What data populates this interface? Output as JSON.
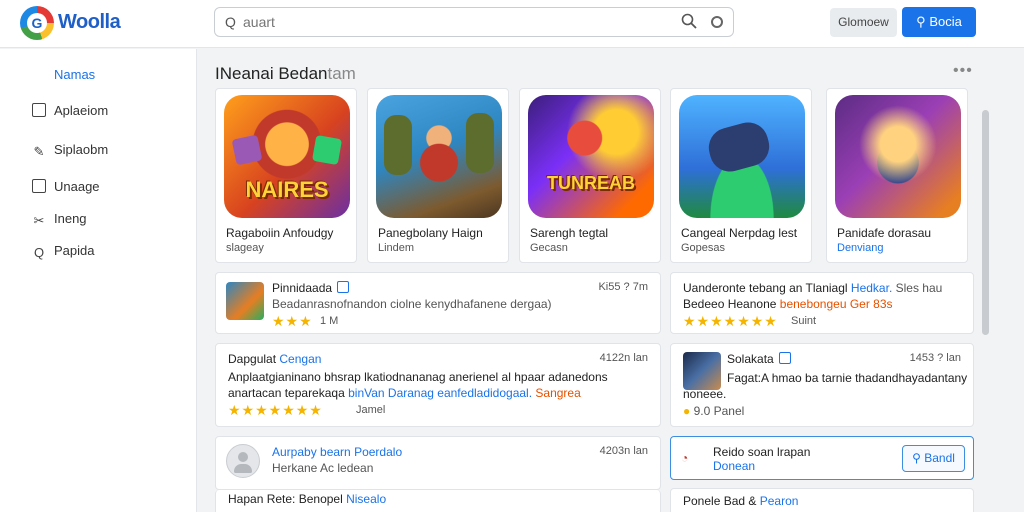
{
  "header": {
    "brand": "Woolla",
    "search_placeholder": "auart",
    "secondary_button": "Glomoew",
    "primary_button": "Bocia"
  },
  "sidebar": {
    "heading": "Namas",
    "items": [
      {
        "label": "Aplaeiom",
        "icon": "square-icon"
      },
      {
        "label": "Siplaobm",
        "icon": "pencil-icon"
      },
      {
        "label": "Unaage",
        "icon": "square-icon"
      },
      {
        "label": "Ineng",
        "icon": "scissors-icon"
      },
      {
        "label": "Papida",
        "icon": "search-icon"
      }
    ]
  },
  "main": {
    "section_title": "INeanai Bedan",
    "section_title_faded": "tam",
    "featured": [
      {
        "tile_word": "NAIRES",
        "title": "Ragaboiin Anfoudgy",
        "subtitle": "slageay",
        "subtitle_blue": false
      },
      {
        "tile_word": "",
        "title": "Panegbolany Haign",
        "subtitle": "Lindem",
        "subtitle_blue": false
      },
      {
        "tile_word": "TUNREAB",
        "title": "Sarengh tegtal",
        "subtitle": "Gecasn",
        "subtitle_blue": false
      },
      {
        "tile_word": "",
        "title": "Cangeal Nerpdag lest",
        "subtitle": "Gopesas",
        "subtitle_blue": false
      },
      {
        "tile_word": "",
        "title": "Panidafe dorasau",
        "subtitle": "Denviang",
        "subtitle_blue": true
      }
    ],
    "reviews": {
      "r1": {
        "name": "Pinnidaada",
        "time": "Ki55 ? 7m",
        "text": "Beadanrasnofnandon ciolne kenydhafanene dergaa)",
        "rating_text": "1 M"
      },
      "r2": {
        "title": "Uanderonte tebang an Tlaniagl",
        "title_blue": "Hedkar.",
        "title_tail": "Sles hau",
        "line2": "Bedeeo Heanone",
        "line2_orange": "benebongeu Ger 83s",
        "rating_text": "Suint"
      },
      "r3": {
        "name": "Dapgulat",
        "name_blue": "Cengan",
        "time": "4122n lan",
        "line1": "Anplaatgianinano bhsrap lkatiodnananag anerienel al hpaar adanedons",
        "line2": "anartacan teparekaqa",
        "line2_blue": "binVan Daranag eanfedladidogaal.",
        "line2_orange": "Sangrea",
        "rating_text": "Jamel"
      },
      "r4": {
        "name": "Solakata",
        "time": "1453 ? lan",
        "line1": "Fagat:A hmao ba tarnie thadandhayadantany",
        "line2": "noneee.",
        "rating_text": "9.0 Panel"
      },
      "r5": {
        "name": "Aurpaby bearn",
        "name_blue": "Poerdalo",
        "time": "4203n lan",
        "line2": "Herkane Ac ledean"
      },
      "r6": {
        "title": "Reido soan lrapan",
        "subtitle": "Donean",
        "button": "Bandl"
      },
      "r7": {
        "text": "Hapan Rete: Benopel",
        "text_blue": "Nisealo"
      },
      "r8": {
        "text": "Ponele Bad &",
        "text_blue": "Pearon"
      }
    }
  },
  "colors": {
    "accent": "#1a73e8",
    "star": "#f4b400",
    "orange": "#e65100"
  }
}
